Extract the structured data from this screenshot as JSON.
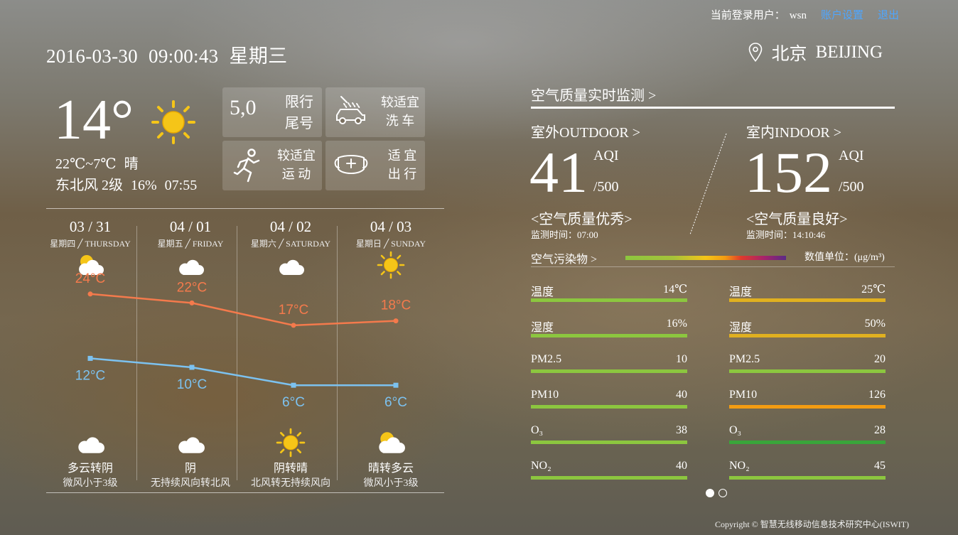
{
  "user_bar": {
    "login_label": "当前登录用户：",
    "username": "wsn",
    "settings": "账户设置",
    "logout": "退出"
  },
  "datetime": {
    "date": "2016-03-30",
    "time": "09:00:43",
    "weekday": "星期三"
  },
  "location": {
    "city_cn": "北京",
    "city_en": "BEIJING"
  },
  "current": {
    "temp": "14°",
    "range": "22℃~7℃",
    "condition": "晴",
    "wind": "东北风 2级",
    "humidity": "16%",
    "time": "07:55"
  },
  "tiles": {
    "plate_numbers": "5,0",
    "plate_label1": "限行",
    "plate_label2": "尾号",
    "carwash1": "较适宜",
    "carwash2": "洗  车",
    "sport1": "较适宜",
    "sport2": "运  动",
    "travel1": "适  宜",
    "travel2": "出  行"
  },
  "forecast": [
    {
      "date": "03 / 31",
      "weekday_cn": "星期四",
      "weekday_en": "THURSDAY",
      "high": "24°C",
      "low": "12°C",
      "condition": "多云转阴",
      "wind": "微风小于3级",
      "icon_top": "partly-cloudy-icon",
      "icon_bottom": "cloud-icon"
    },
    {
      "date": "04 / 01",
      "weekday_cn": "星期五",
      "weekday_en": "FRIDAY",
      "high": "22°C",
      "low": "10°C",
      "condition": "阴",
      "wind": "无持续风向转北风",
      "icon_top": "cloud-icon",
      "icon_bottom": "cloud-icon"
    },
    {
      "date": "04 / 02",
      "weekday_cn": "星期六",
      "weekday_en": "SATURDAY",
      "high": "17°C",
      "low": "6°C",
      "condition": "阴转晴",
      "wind": "北风转无持续风向",
      "icon_top": "cloud-icon",
      "icon_bottom": "sun-icon"
    },
    {
      "date": "04 / 03",
      "weekday_cn": "星期日",
      "weekday_en": "SUNDAY",
      "high": "18°C",
      "low": "6°C",
      "condition": "晴转多云",
      "wind": "微风小于3级",
      "icon_top": "sun-icon",
      "icon_bottom": "partly-cloudy-icon"
    }
  ],
  "chart_data": {
    "type": "line",
    "categories": [
      "03/31",
      "04/01",
      "04/02",
      "04/03"
    ],
    "series": [
      {
        "values": [
          24,
          22,
          17,
          18
        ],
        "color": "#f47a4c"
      },
      {
        "values": [
          12,
          10,
          6,
          6
        ],
        "color": "#7cc2f0"
      }
    ]
  },
  "air": {
    "title": "空气质量实时监测 >",
    "outdoor": {
      "label": "室外OUTDOOR >",
      "aqi": "41",
      "aqi_label": "AQI",
      "max": "/500",
      "quality": "<空气质量优秀>",
      "time": "监测时间：07:00"
    },
    "indoor": {
      "label": "室内INDOOR >",
      "aqi": "152",
      "aqi_label": "AQI",
      "max": "/500",
      "quality": "<空气质量良好>",
      "time": "监测时间：14:10:46"
    },
    "pollutant_label": "空气污染物 >",
    "unit": "数值单位：(μg/m³)",
    "outdoor_rows": [
      {
        "name": "温度",
        "value": "14℃",
        "color": "#8cc63f"
      },
      {
        "name": "湿度",
        "value": "16%",
        "color": "#8cc63f"
      },
      {
        "name": "PM2.5",
        "value": "10",
        "color": "#8cc63f"
      },
      {
        "name": "PM10",
        "value": "40",
        "color": "#8cc63f"
      },
      {
        "name": "O₃",
        "value": "38",
        "color": "#8cc63f"
      },
      {
        "name": "NO₂",
        "value": "40",
        "color": "#8cc63f"
      }
    ],
    "indoor_rows": [
      {
        "name": "温度",
        "value": "25℃",
        "color": "#e0b020"
      },
      {
        "name": "湿度",
        "value": "50%",
        "color": "#e0b020"
      },
      {
        "name": "PM2.5",
        "value": "20",
        "color": "#8cc63f"
      },
      {
        "name": "PM10",
        "value": "126",
        "color": "#f39c12"
      },
      {
        "name": "O₃",
        "value": "28",
        "color": "#3aa53a"
      },
      {
        "name": "NO₂",
        "value": "45",
        "color": "#8cc63f"
      }
    ]
  },
  "copyright": "Copyright © 智慧无线移动信息技术研究中心(ISWIT)"
}
